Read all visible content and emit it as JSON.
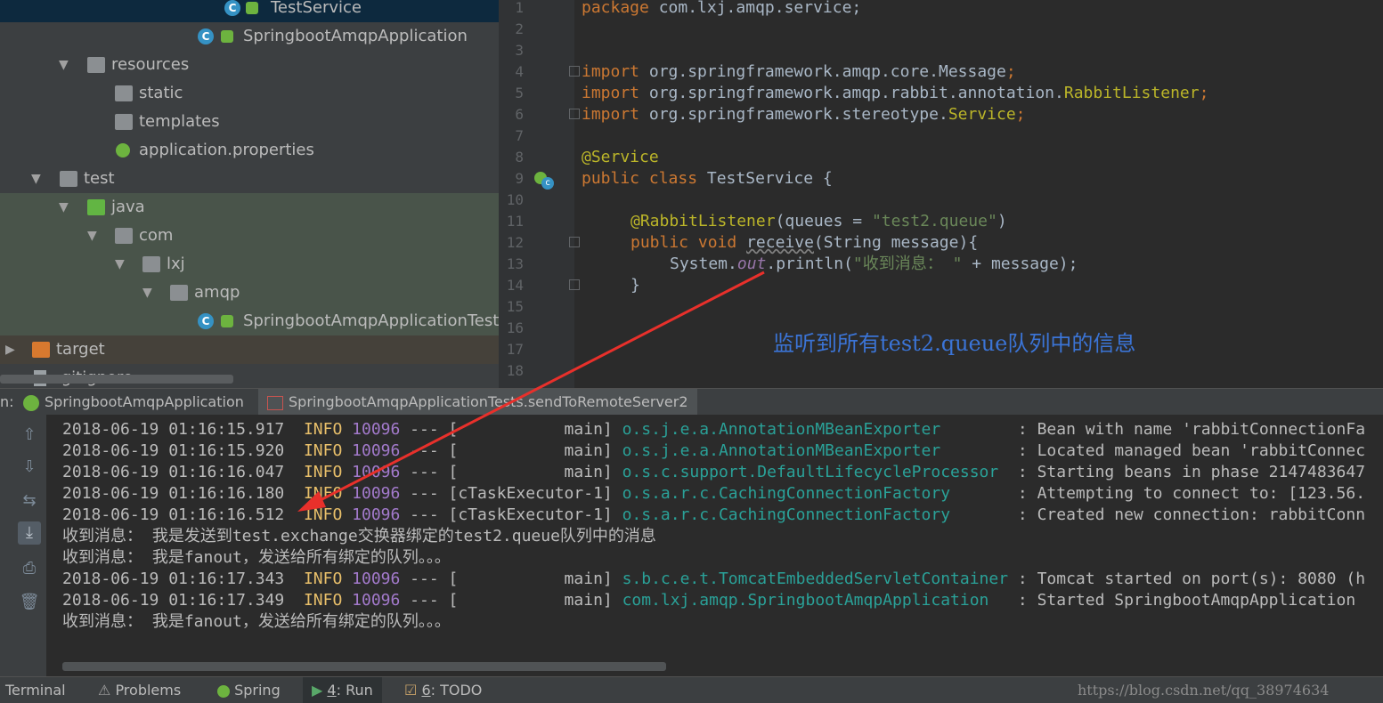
{
  "project_tree": {
    "items": [
      {
        "label": "TestService"
      },
      {
        "label": "SpringbootAmqpApplication"
      },
      {
        "label": "resources"
      },
      {
        "label": "static"
      },
      {
        "label": "templates"
      },
      {
        "label": "application.properties"
      },
      {
        "label": "test"
      },
      {
        "label": "java"
      },
      {
        "label": "com"
      },
      {
        "label": "lxj"
      },
      {
        "label": "amqp"
      },
      {
        "label": "SpringbootAmqpApplicationTest"
      },
      {
        "label": "target"
      },
      {
        "label": ".gitignore"
      }
    ]
  },
  "editor": {
    "line_numbers": [
      "1",
      "2",
      "3",
      "4",
      "5",
      "6",
      "7",
      "8",
      "9",
      "10",
      "11",
      "12",
      "13",
      "14",
      "15",
      "16",
      "17",
      "18"
    ],
    "l1": {
      "kw": "package",
      "rest": " com.lxj.amqp.service;"
    },
    "l4": {
      "kw": "import",
      "pkg": " org.springframework.amqp.core.",
      "cls": "Message",
      "semi": ";"
    },
    "l5": {
      "kw": "import",
      "pkg": " org.springframework.amqp.rabbit.annotation.",
      "cls": "RabbitListener",
      "semi": ";"
    },
    "l6": {
      "kw": "import",
      "pkg": " org.springframework.stereotype.",
      "cls": "Service",
      "semi": ";"
    },
    "l8": {
      "ann": "@Service"
    },
    "l9": {
      "kw": "public class",
      "rest": " TestService {"
    },
    "l11": {
      "ann": "@RabbitListener",
      "p1": "(queues = ",
      "str": "\"test2.queue\"",
      "p2": ")"
    },
    "l12": {
      "kw": "public void",
      "sp": " ",
      "method": "receive",
      "rest": "(String message){"
    },
    "l13": {
      "p1": "System.",
      "field": "out",
      "p2": ".println(",
      "str": "\"收到消息： \"",
      "p3": " + message);"
    },
    "l14": {
      "rest": "}"
    },
    "note": "监听到所有test2.queue队列中的信息"
  },
  "run_tabs": {
    "prefix": "n:",
    "tab1": "SpringbootAmqpApplication",
    "tab2": "SpringbootAmqpApplicationTests.sendToRemoteServer2"
  },
  "console": {
    "lines": [
      {
        "ts": "2018-06-19 01:16:15.917",
        "lvl": "INFO",
        "pid": "10096",
        "thread": " --- [           main] ",
        "logger": "o.s.j.e.a.AnnotationMBeanExporter       ",
        "msg": " : Bean with name 'rabbitConnectionFa"
      },
      {
        "ts": "2018-06-19 01:16:15.920",
        "lvl": "INFO",
        "pid": "10096",
        "thread": " --- [           main] ",
        "logger": "o.s.j.e.a.AnnotationMBeanExporter       ",
        "msg": " : Located managed bean 'rabbitConnec"
      },
      {
        "ts": "2018-06-19 01:16:16.047",
        "lvl": "INFO",
        "pid": "10096",
        "thread": " --- [           main] ",
        "logger": "o.s.c.support.DefaultLifecycleProcessor ",
        "msg": " : Starting beans in phase 2147483647"
      },
      {
        "ts": "2018-06-19 01:16:16.180",
        "lvl": "INFO",
        "pid": "10096",
        "thread": " --- [cTaskExecutor-1] ",
        "logger": "o.s.a.r.c.CachingConnectionFactory      ",
        "msg": " : Attempting to connect to: [123.56."
      },
      {
        "ts": "2018-06-19 01:16:16.512",
        "lvl": "INFO",
        "pid": "10096",
        "thread": " --- [cTaskExecutor-1] ",
        "logger": "o.s.a.r.c.CachingConnectionFactory      ",
        "msg": " : Created new connection: rabbitConn"
      },
      {
        "ts": "2018-06-19 01:16:17.343",
        "lvl": "INFO",
        "pid": "10096",
        "thread": " --- [           main] ",
        "logger": "s.b.c.e.t.TomcatEmbeddedServletContainer",
        "msg": " : Tomcat started on port(s): 8080 (h"
      },
      {
        "ts": "2018-06-19 01:16:17.349",
        "lvl": "INFO",
        "pid": "10096",
        "thread": " --- [           main] ",
        "logger": "com.lxj.amqp.SpringbootAmqpApplication  ",
        "msg": " : Started SpringbootAmqpApplication "
      }
    ],
    "plain": [
      "收到消息： 我是发送到test.exchange交换器绑定的test2.queue队列中的消息",
      "收到消息： 我是fanout，发送给所有绑定的队列。。。",
      "收到消息： 我是fanout，发送给所有绑定的队列。。。"
    ]
  },
  "toolbar": {
    "terminal": "Terminal",
    "problems": "Problems",
    "spring": "Spring",
    "run_num": "4",
    "run_label": ": Run",
    "todo_num": "6",
    "todo_label": ": TODO"
  },
  "watermark": "https://blog.csdn.net/qq_38974634"
}
